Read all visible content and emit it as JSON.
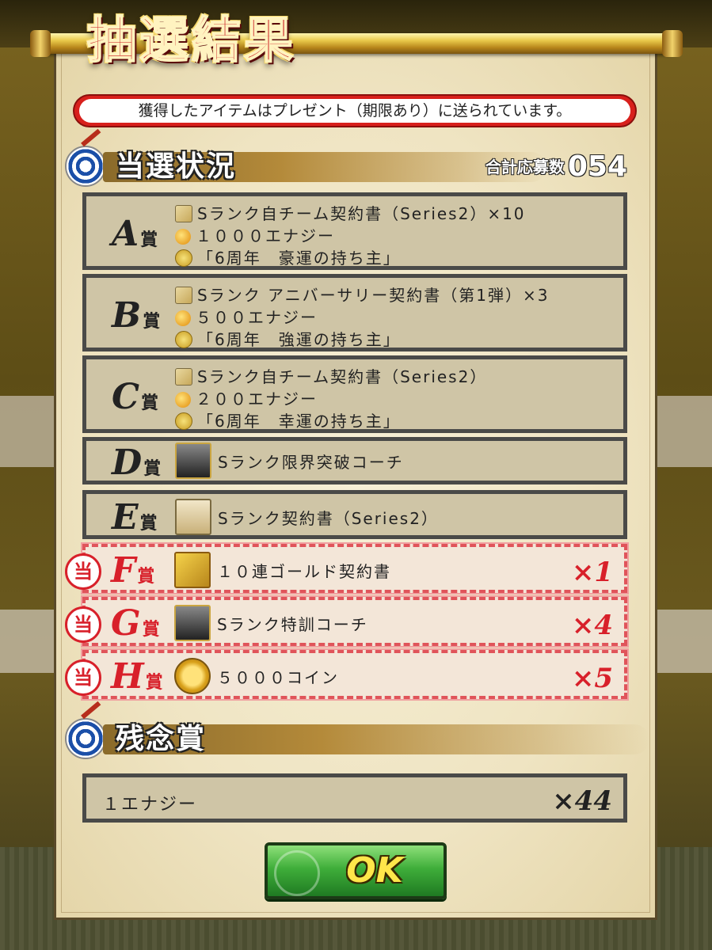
{
  "title": "抽選結果",
  "notice": "獲得したアイテムはプレゼント（期限あり）に送られています。",
  "status_section": {
    "title": "当選状況",
    "count_label": "合計応募数",
    "count_value": "054"
  },
  "prizes": [
    {
      "grade": "A",
      "suffix": "賞",
      "won": false,
      "lines": [
        "Sランク自チーム契約書（Series2）×10",
        "１０００エナジー",
        "「6周年　豪運の持ち主」"
      ],
      "icons": [
        "book-icon",
        "energy-icon",
        "special-icon"
      ]
    },
    {
      "grade": "B",
      "suffix": "賞",
      "won": false,
      "lines": [
        "Sランク アニバーサリー契約書（第1弾）×3",
        "５００エナジー",
        "「6周年　強運の持ち主」"
      ],
      "icons": [
        "book-icon",
        "energy-icon",
        "special-icon"
      ]
    },
    {
      "grade": "C",
      "suffix": "賞",
      "won": false,
      "lines": [
        "Sランク自チーム契約書（Series2）",
        "２００エナジー",
        "「6周年　幸運の持ち主」"
      ],
      "icons": [
        "book-icon",
        "energy-icon",
        "special-icon"
      ]
    },
    {
      "grade": "D",
      "suffix": "賞",
      "won": false,
      "lines": [
        "Sランク限界突破コーチ"
      ],
      "icons": [
        "coach-icon"
      ]
    },
    {
      "grade": "E",
      "suffix": "賞",
      "won": false,
      "lines": [
        "Sランク契約書（Series2）"
      ],
      "icons": [
        "series-book-icon"
      ]
    },
    {
      "grade": "F",
      "suffix": "賞",
      "won": true,
      "seal": "当",
      "lines": [
        "１０連ゴールド契約書"
      ],
      "icons": [
        "gold-contract-icon"
      ],
      "qty": "×1"
    },
    {
      "grade": "G",
      "suffix": "賞",
      "won": true,
      "seal": "当",
      "lines": [
        "Sランク特訓コーチ"
      ],
      "icons": [
        "coach-icon"
      ],
      "qty": "×4"
    },
    {
      "grade": "H",
      "suffix": "賞",
      "won": true,
      "seal": "当",
      "lines": [
        "５０００コイン"
      ],
      "icons": [
        "coin-icon"
      ],
      "qty": "×5"
    }
  ],
  "consolation_section": {
    "title": "残念賞",
    "item": "１エナジー",
    "qty": "×44"
  },
  "ok_button": "OK",
  "colors": {
    "accent_red": "#d8202a",
    "ok_green": "#3fae3a",
    "ok_text": "#ffe64a"
  }
}
